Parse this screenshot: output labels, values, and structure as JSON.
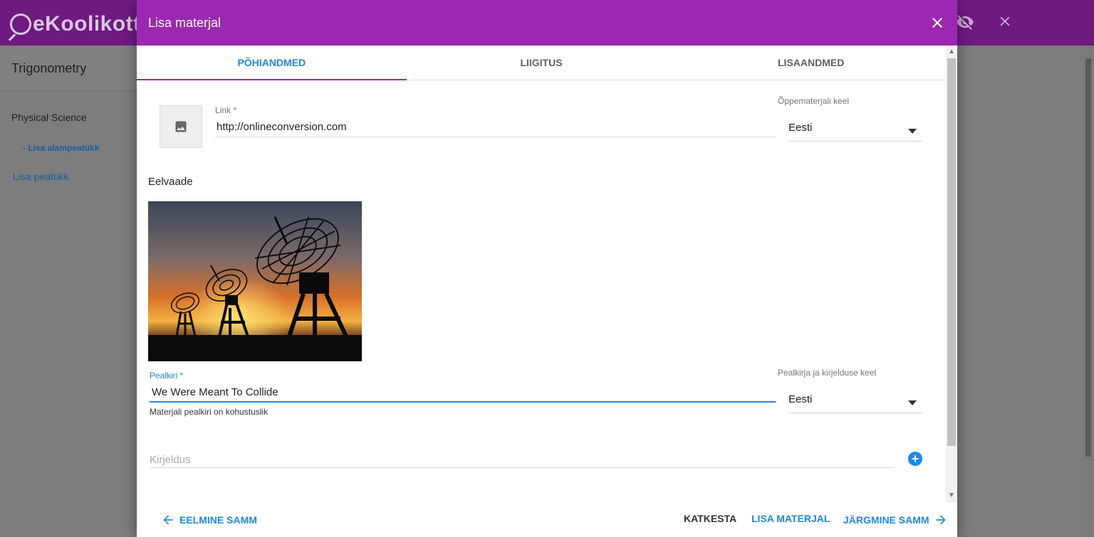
{
  "app": {
    "logo": "eKoolikott",
    "sidebar": {
      "title": "Trigonometry",
      "chapter": "Physical Science",
      "add_subchapter": "- Lisa alampeatükk",
      "add_chapter": "Lisa peatükk"
    }
  },
  "modal": {
    "title": "Lisa materjal",
    "tabs": [
      {
        "label": "PÕHIANDMED",
        "active": true
      },
      {
        "label": "LIIGITUS",
        "active": false
      },
      {
        "label": "LISAANDMED",
        "active": false
      }
    ],
    "link": {
      "label": "Link *",
      "value": "http://onlineconversion.com"
    },
    "material_language": {
      "label": "Õppematerjali keel",
      "value": "Eesti"
    },
    "preview_title": "Eelvaade",
    "title_field": {
      "label": "Pealkiri *",
      "value": "We Were Meant To Collide",
      "hint": "Materjali pealkiri on kohustuslik"
    },
    "title_language": {
      "label": "Pealkirja ja kirjelduse keel",
      "value": "Eesti"
    },
    "description": {
      "placeholder": "Kirjeldus"
    },
    "footer": {
      "prev": "EELMINE SAMM",
      "cancel": "KATKESTA",
      "add": "LISA MATERJAL",
      "next": "JÄRGMINE SAMM"
    }
  },
  "colors": {
    "header_purple": "#9c27b0",
    "accent_blue": "#1e88e5"
  }
}
